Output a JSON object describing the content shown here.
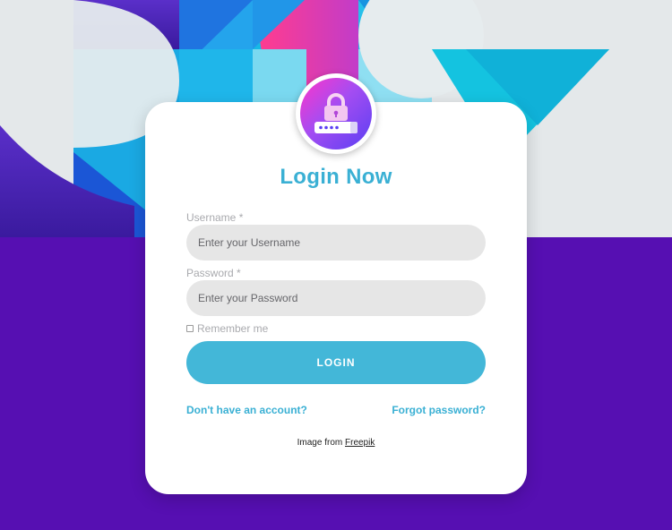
{
  "form": {
    "title": "Login Now",
    "username_label": "Username *",
    "username_placeholder": "Enter your Username",
    "password_label": "Password *",
    "password_placeholder": "Enter your Password",
    "remember_label": "Remember me",
    "login_label": "LOGIN",
    "signup_link": "Don't have an account?",
    "forgot_link": "Forgot password?"
  },
  "credit": {
    "prefix": "Image from",
    "link": "Freepik"
  },
  "icons": {
    "avatar": "lock-password-icon"
  },
  "colors": {
    "accent": "#3ab0d4",
    "button": "#43b7d8",
    "background_bottom": "#560fb2",
    "background_top": "#e4e8ea",
    "input_bg": "#e6e6e6"
  }
}
